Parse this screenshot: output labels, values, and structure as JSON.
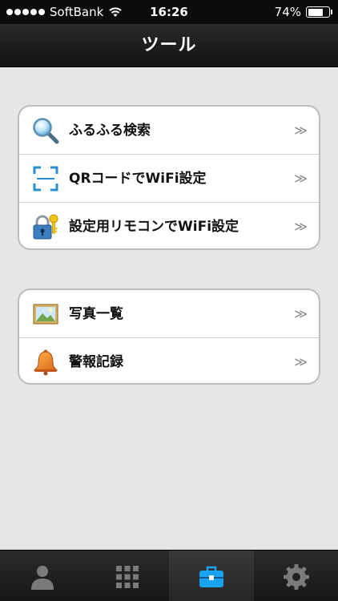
{
  "status_bar": {
    "carrier": "SoftBank",
    "time": "16:26",
    "battery_percent": "74%",
    "battery_level": 0.74
  },
  "navbar": {
    "title": "ツール"
  },
  "groups": [
    {
      "rows": [
        {
          "label": "ふるふる検索",
          "icon": "magnifier-icon",
          "chevron": "≫"
        },
        {
          "label": "QRコードでWiFi設定",
          "icon": "qr-frame-icon",
          "chevron": "≫"
        },
        {
          "label": "設定用リモコンでWiFi設定",
          "icon": "lock-key-icon",
          "chevron": "≫"
        }
      ]
    },
    {
      "rows": [
        {
          "label": "写真一覧",
          "icon": "photo-icon",
          "chevron": "≫"
        },
        {
          "label": "警報記録",
          "icon": "bell-icon",
          "chevron": "≫"
        }
      ]
    }
  ],
  "tabbar": {
    "tabs": [
      {
        "icon": "person-icon",
        "active": false
      },
      {
        "icon": "grid-icon",
        "active": false
      },
      {
        "icon": "toolbox-icon",
        "active": true,
        "color": "#1aa3f0"
      },
      {
        "icon": "gear-icon",
        "active": false
      }
    ],
    "inactive_color": "#7a7a7a"
  }
}
